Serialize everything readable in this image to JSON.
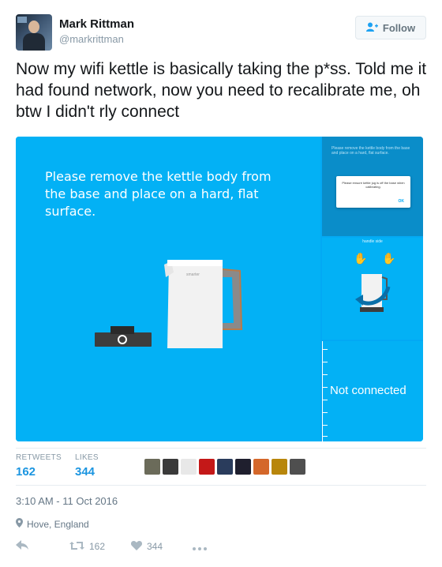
{
  "author": {
    "name": "Mark Rittman",
    "handle": "@markrittman"
  },
  "follow_button": {
    "label": "Follow"
  },
  "tweet": {
    "text": "Now my wifi kettle is basically taking the p*ss. Told me it had found network, now you need to recalibrate me, oh btw I didn't rly connect"
  },
  "media": {
    "main_instruction": "Please remove the kettle body from the base and place on a hard, flat surface.",
    "kettle_brand": "smarter",
    "side1_text": "Please remove the kettle body from the base and place on a hard, flat surface.",
    "dialog_text": "Please ensure kettle jug is off the base when calibrating.",
    "dialog_ok": "OK",
    "handle_side_label": "handle side",
    "not_connected": "Not connected"
  },
  "stats": {
    "retweets_label": "RETWEETS",
    "retweets_value": "162",
    "likes_label": "LIKES",
    "likes_value": "344"
  },
  "likers_colors": [
    "#6b6b5a",
    "#3a3a3a",
    "#e8e8e8",
    "#c41818",
    "#2a3c5c",
    "#1f1f2e",
    "#d4672a",
    "#b8860b",
    "#4f4f4f"
  ],
  "timestamp": "3:10 AM - 11 Oct 2016",
  "location": "Hove, England",
  "actions": {
    "retweet_count": "162",
    "like_count": "344"
  },
  "colors": {
    "accent": "#1da1f2",
    "media_blue": "#03b1f5"
  }
}
